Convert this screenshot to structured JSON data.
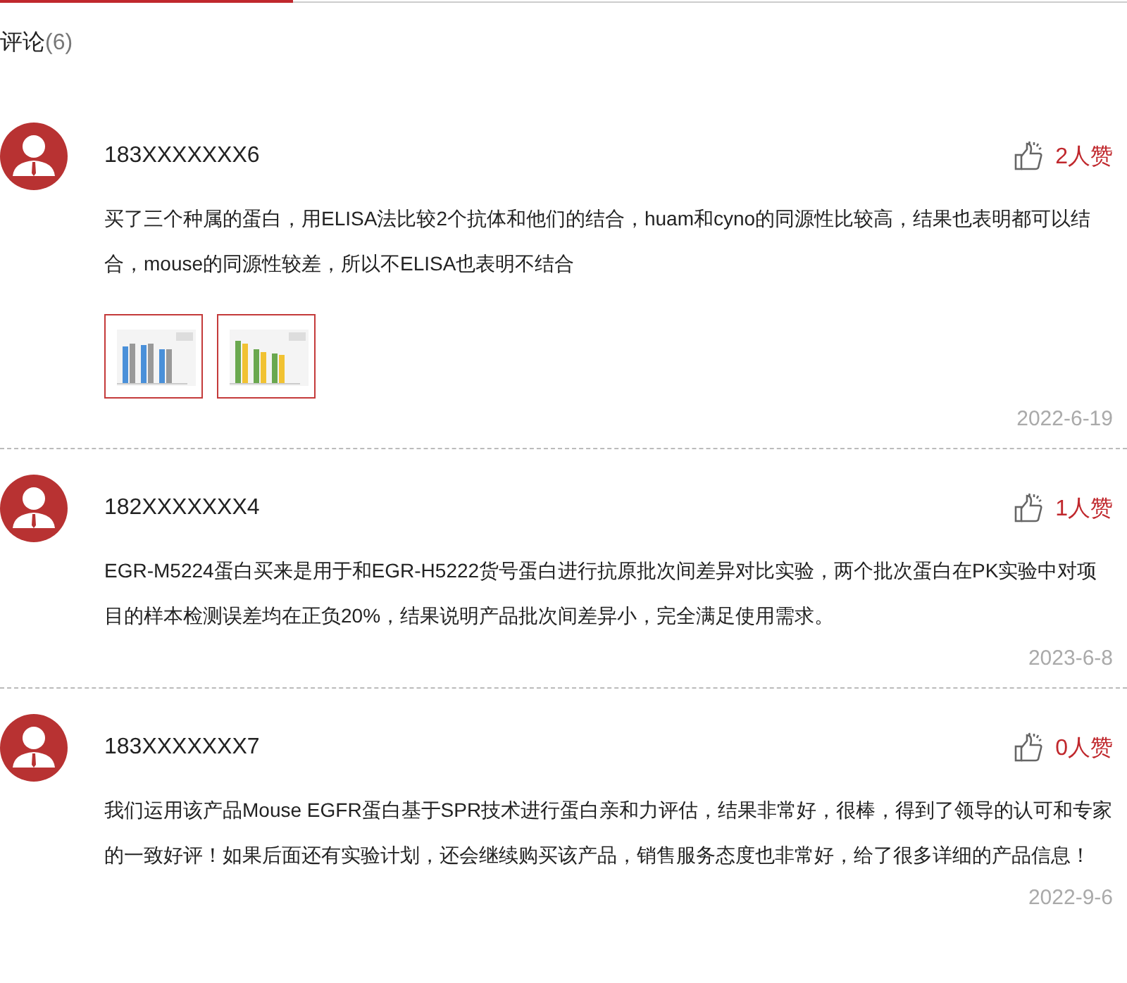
{
  "header": {
    "title": "评论",
    "count": "(6)"
  },
  "comments": [
    {
      "user": "183XXXXXXX6",
      "likes": "2人赞",
      "text": "买了三个种属的蛋白，用ELISA法比较2个抗体和他们的结合，huam和cyno的同源性比较高，结果也表明都可以结合，mouse的同源性较差，所以不ELISA也表明不结合",
      "date": "2022-6-19"
    },
    {
      "user": "182XXXXXXX4",
      "likes": "1人赞",
      "text": "EGR-M5224蛋白买来是用于和EGR-H5222货号蛋白进行抗原批次间差异对比实验，两个批次蛋白在PK实验中对项目的样本检测误差均在正负20%，结果说明产品批次间差异小，完全满足使用需求。",
      "date": "2023-6-8"
    },
    {
      "user": "183XXXXXXX7",
      "likes": "0人赞",
      "text": "我们运用该产品Mouse EGFR蛋白基于SPR技术进行蛋白亲和力评估，结果非常好，很棒，得到了领导的认可和专家的一致好评！如果后面还有实验计划，还会继续购买该产品，销售服务态度也非常好，给了很多详细的产品信息！",
      "date": "2022-9-6"
    }
  ]
}
